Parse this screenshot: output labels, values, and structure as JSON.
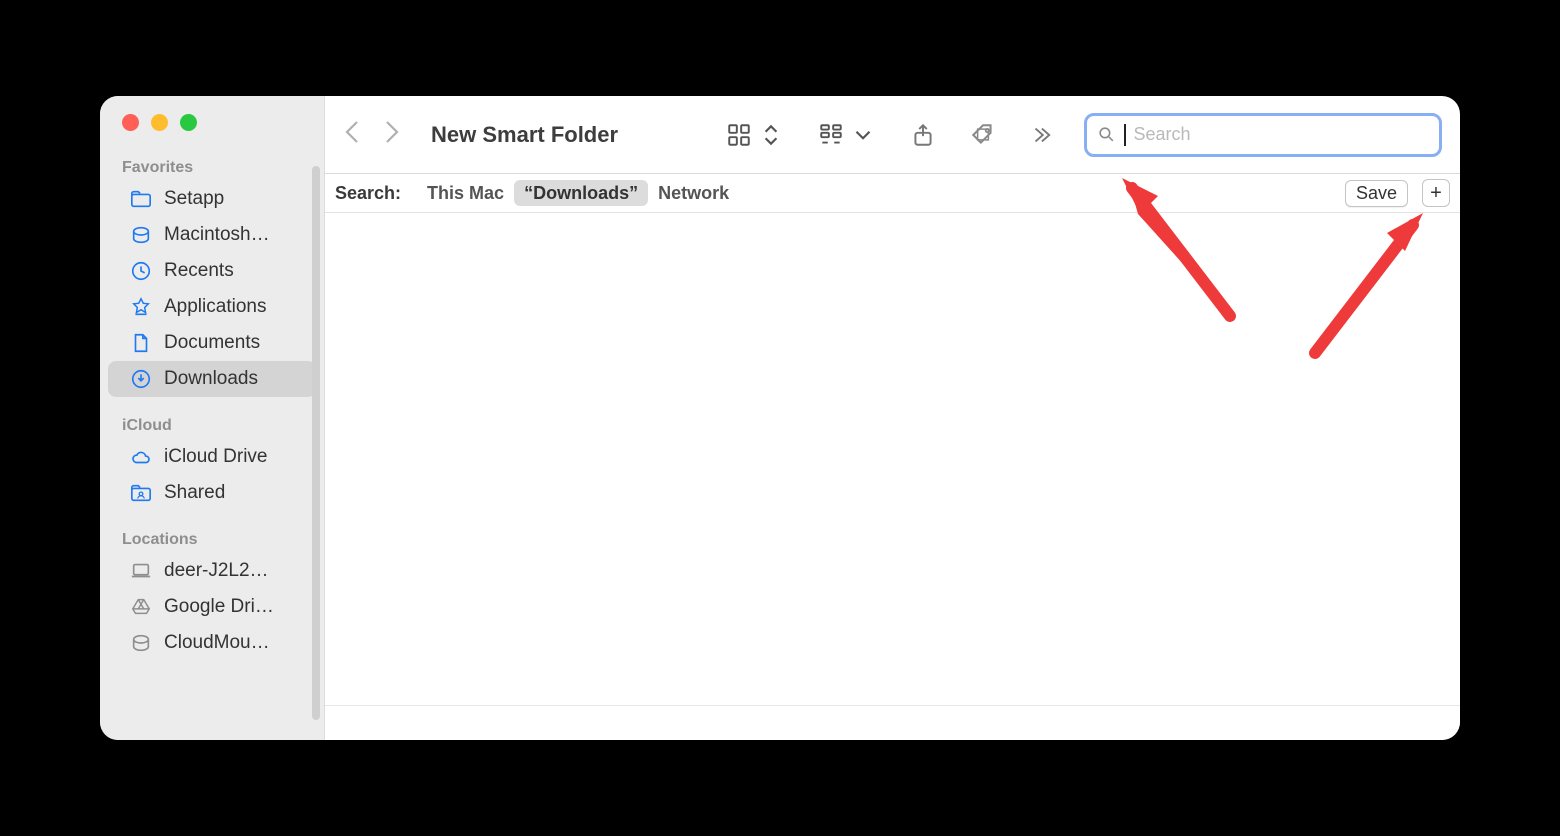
{
  "window": {
    "title": "New Smart Folder"
  },
  "search": {
    "placeholder": "Search",
    "value": ""
  },
  "sidebar": {
    "sections": [
      {
        "label": "Favorites",
        "items": [
          {
            "icon": "folder",
            "label": "Setapp"
          },
          {
            "icon": "disk",
            "label": "Macintosh…"
          },
          {
            "icon": "clock",
            "label": "Recents"
          },
          {
            "icon": "apps",
            "label": "Applications"
          },
          {
            "icon": "doc",
            "label": "Documents"
          },
          {
            "icon": "download",
            "label": "Downloads",
            "active": true
          }
        ]
      },
      {
        "label": "iCloud",
        "items": [
          {
            "icon": "cloud",
            "label": "iCloud Drive"
          },
          {
            "icon": "sharedfolder",
            "label": "Shared"
          }
        ]
      },
      {
        "label": "Locations",
        "items": [
          {
            "icon": "laptop",
            "label": "deer-J2L2…"
          },
          {
            "icon": "gdrive",
            "label": "Google Dri…"
          },
          {
            "icon": "extdisk",
            "label": "CloudMou…"
          }
        ]
      }
    ]
  },
  "scopebar": {
    "label": "Search:",
    "scopes": [
      {
        "label": "This Mac"
      },
      {
        "label": "“Downloads”",
        "active": true
      },
      {
        "label": "Network"
      }
    ],
    "save_label": "Save",
    "plus_label": "+"
  }
}
